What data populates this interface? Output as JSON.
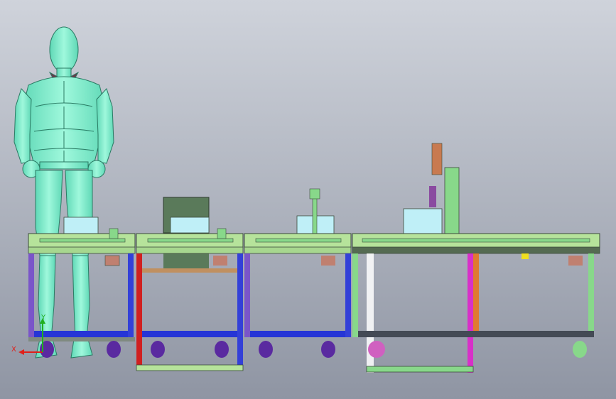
{
  "viewport": {
    "background_top": "#cfd3db",
    "background_bottom": "#8f95a3"
  },
  "axis_triad": {
    "x_label": "X",
    "y_label": "Y",
    "x_color": "#e0201a",
    "y_color": "#20b020"
  },
  "colors": {
    "mannequin": "#7ff0cf",
    "mannequin_edge": "#2a7a63",
    "collar": "#6a3548",
    "frame_top": "#b6e39b",
    "frame_dark": "#3b4a3a",
    "rail_green": "#88d88a",
    "leg_blue": "#3340d8",
    "leg_purple": "#7a55c9",
    "crossbar_blue": "#2635d6",
    "crossbar_dark": "#444a55",
    "pallet": "#bfeff7",
    "dark_box": "#5a7a5a",
    "red_post": "#d02020",
    "magenta_post": "#d830c8",
    "orange_post": "#e07a30",
    "yellow": "#f0e020",
    "caster_purple": "#5a2aa0",
    "caster_magenta": "#d060c0"
  }
}
